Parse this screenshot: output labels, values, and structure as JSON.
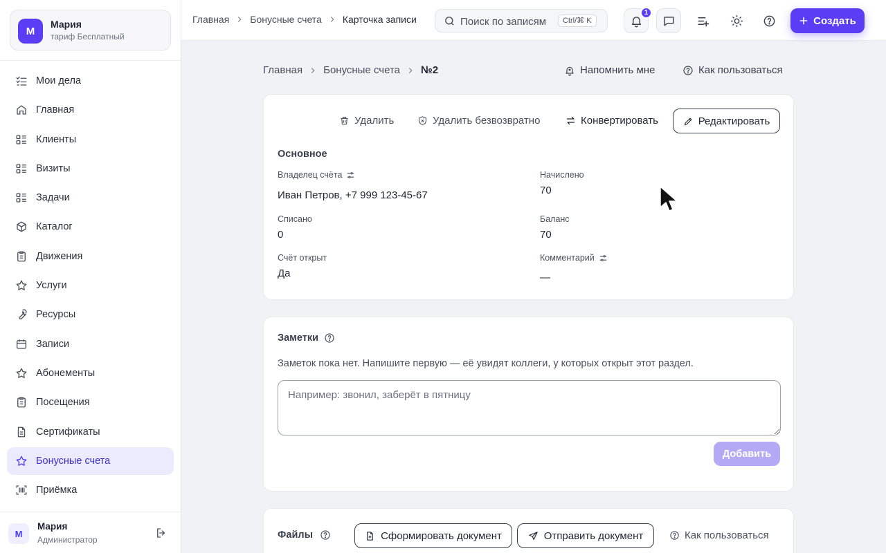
{
  "account": {
    "initial": "М",
    "name": "Мария",
    "plan": "тариф Бесплатный"
  },
  "sidebar": {
    "items": [
      {
        "label": "Мои дела",
        "icon": "checklist-icon"
      },
      {
        "label": "Главная",
        "icon": "home-icon"
      },
      {
        "label": "Клиенты",
        "icon": "list-icon"
      },
      {
        "label": "Визиты",
        "icon": "list-icon"
      },
      {
        "label": "Задачи",
        "icon": "list-icon"
      },
      {
        "label": "Каталог",
        "icon": "box-icon"
      },
      {
        "label": "Движения",
        "icon": "clipboard-icon"
      },
      {
        "label": "Услуги",
        "icon": "star-icon"
      },
      {
        "label": "Ресурсы",
        "icon": "wrench-icon"
      },
      {
        "label": "Записи",
        "icon": "calendar-icon"
      },
      {
        "label": "Абонементы",
        "icon": "star-icon"
      },
      {
        "label": "Посещения",
        "icon": "clipboard-icon"
      },
      {
        "label": "Сертификаты",
        "icon": "document-icon"
      },
      {
        "label": "Бонусные счета",
        "icon": "star-icon",
        "active": true
      },
      {
        "label": "Приёмка",
        "icon": "barcode-icon"
      }
    ]
  },
  "user": {
    "initial": "М",
    "name": "Мария",
    "role": "Администратор"
  },
  "topbar": {
    "breadcrumbs": [
      "Главная",
      "Бонусные счета",
      "Карточка записи"
    ],
    "search_placeholder": "Поиск по записям",
    "search_shortcut": "Ctrl/⌘ K",
    "notifications_count": "1",
    "create_label": "Создать"
  },
  "page": {
    "breadcrumbs": [
      "Главная",
      "Бонусные счета",
      "№2"
    ],
    "remind_label": "Напомнить мне",
    "help_label": "Как пользоваться"
  },
  "record": {
    "actions": {
      "delete": "Удалить",
      "delete_forever": "Удалить безвозвратно",
      "convert": "Конвертировать",
      "edit": "Редактировать"
    },
    "section_title": "Основное",
    "fields": {
      "owner_label": "Владелец счёта",
      "owner_value": "Иван Петров, +7 999 123-45-67",
      "accrued_label": "Начислено",
      "accrued_value": "70",
      "written_off_label": "Списано",
      "written_off_value": "0",
      "balance_label": "Баланс",
      "balance_value": "70",
      "opened_label": "Счёт открыт",
      "opened_value": "Да",
      "comment_label": "Комментарий",
      "comment_value": "—"
    }
  },
  "notes": {
    "title": "Заметки",
    "empty_text": "Заметок пока нет. Напишите первую — её увидят коллеги, у которых открыт этот раздел.",
    "placeholder": "Например: звонил, заберёт в пятницу",
    "add_label": "Добавить"
  },
  "files": {
    "title": "Файлы",
    "generate_label": "Сформировать документ",
    "send_label": "Отправить документ",
    "help_label": "Как пользоваться"
  },
  "colors": {
    "accent": "#5b3df5",
    "accent_soft": "#ecebfd",
    "disabled_button": "#b3a9f5"
  }
}
